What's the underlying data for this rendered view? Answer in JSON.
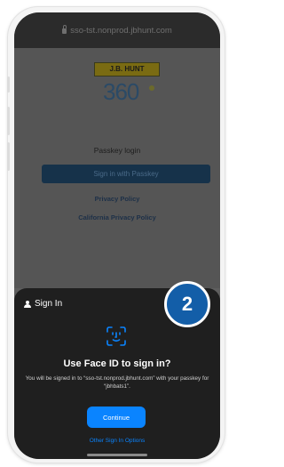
{
  "browser": {
    "url": "sso-tst.nonprod.jbhunt.com"
  },
  "page": {
    "brand_logo_text": "J.B. HUNT",
    "product_logo_text": "360",
    "passkey_label": "Passkey login",
    "passkey_button": "Sign in with Passkey",
    "privacy_link": "Privacy Policy",
    "california_link": "California Privacy Policy"
  },
  "sheet": {
    "header": "Sign In",
    "title": "Use Face ID to sign in?",
    "description": "You will be signed in to “sso-tst.nonprod.jbhunt.com” with your passkey for “jbhbats1”.",
    "continue_label": "Continue",
    "other_options_label": "Other Sign In Options"
  },
  "badge": {
    "step": "2"
  },
  "colors": {
    "accent": "#0a84ff",
    "badge": "#135ea8",
    "sheet_bg": "#1f1f1f"
  },
  "icons": [
    "lock-icon",
    "person-icon",
    "face-id-icon"
  ]
}
